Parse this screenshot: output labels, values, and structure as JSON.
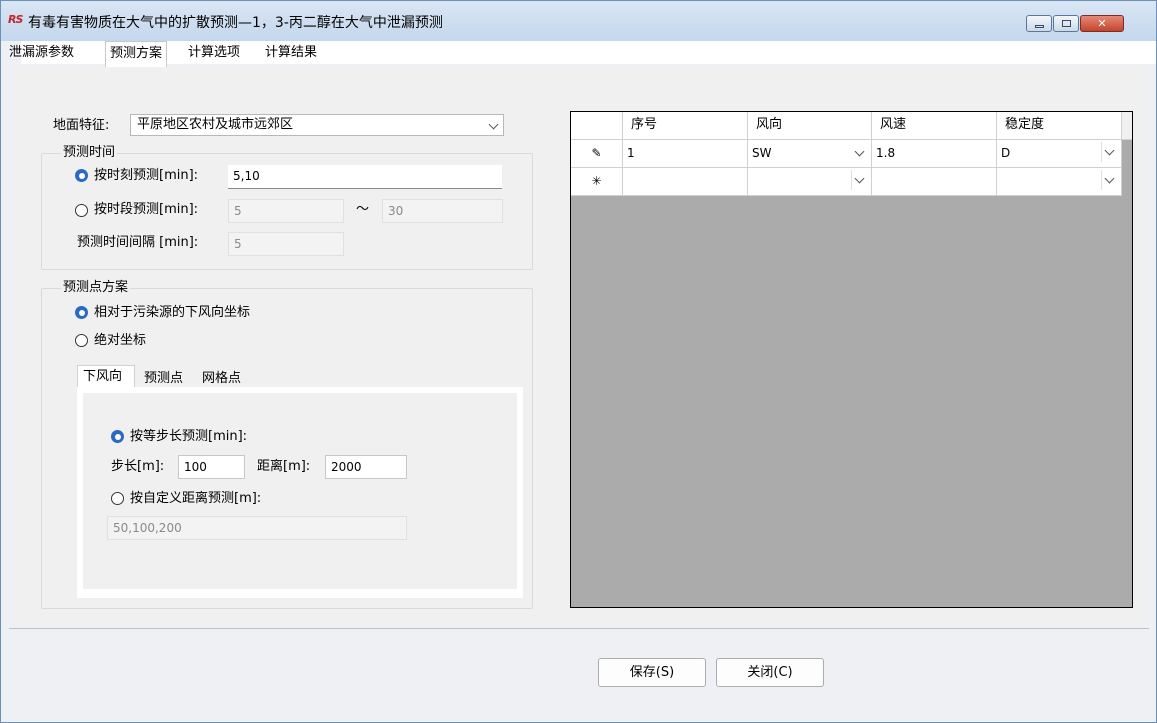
{
  "window": {
    "title": "有毒有害物质在大气中的扩散预测—1，3-丙二醇在大气中泄漏预测",
    "app_icon_text": "RS",
    "close_glyph": "✕"
  },
  "tabs": [
    "泄漏源参数",
    "预测方案",
    "计算选项",
    "计算结果"
  ],
  "surface": {
    "label": "地面特征:",
    "value": "平原地区农村及城市远郊区"
  },
  "forecast_time": {
    "legend": "预测时间",
    "by_moment_label": "按时刻预测[min]:",
    "by_moment_value": "5,10",
    "by_period_label": "按时段预测[min]:",
    "period_from": "5",
    "tilde": "～",
    "period_to": "30",
    "interval_label": "预测时间间隔 [min]:",
    "interval_value": "5"
  },
  "point_scheme": {
    "legend": "预测点方案",
    "relative_label": "相对于污染源的下风向坐标",
    "absolute_label": "绝对坐标",
    "subtabs": [
      "下风向",
      "预测点",
      "网格点"
    ],
    "equal_step_label": "按等步长预测[min]:",
    "step_label": "步长[m]:",
    "step_value": "100",
    "distance_label": "距离[m]:",
    "distance_value": "2000",
    "custom_label": "按自定义距离预测[m]:",
    "custom_value": "50,100,200"
  },
  "grid": {
    "columns": [
      "序号",
      "风向",
      "风速",
      "稳定度"
    ],
    "rows": [
      {
        "marker": "✎",
        "cells": [
          "1",
          "SW",
          "1.8",
          "D"
        ]
      },
      {
        "marker": "✳",
        "cells": [
          "",
          "",
          "",
          ""
        ]
      }
    ]
  },
  "buttons": {
    "save": "保存(S)",
    "close": "关闭(C)"
  }
}
